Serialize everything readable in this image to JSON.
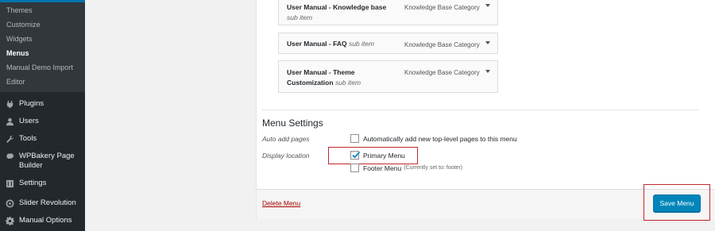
{
  "sidebar": {
    "submenu": [
      {
        "label": "Themes"
      },
      {
        "label": "Customize"
      },
      {
        "label": "Widgets"
      },
      {
        "label": "Menus"
      },
      {
        "label": "Manual Demo Import"
      },
      {
        "label": "Editor"
      }
    ],
    "menu": [
      {
        "label": "Plugins",
        "icon": "plug-icon"
      },
      {
        "label": "Users",
        "icon": "users-icon"
      },
      {
        "label": "Tools",
        "icon": "wrench-icon"
      },
      {
        "label": "WPBakery Page Builder",
        "icon": "wpbakery-icon"
      },
      {
        "label": "Settings",
        "icon": "settings-icon"
      },
      {
        "label": "Slider Revolution",
        "icon": "slider-revolution-icon"
      },
      {
        "label": "Manual Options",
        "icon": "gear-icon"
      }
    ]
  },
  "menu_items": [
    {
      "title": "User Manual - Knowledge base",
      "sub": "sub item",
      "type": "Knowledge Base Category"
    },
    {
      "title": "User Manual - FAQ",
      "sub": "sub item",
      "type": "Knowledge Base Category"
    },
    {
      "title": "User Manual - Theme Customization",
      "sub": "sub item",
      "type": "Knowledge Base Category"
    }
  ],
  "settings": {
    "title": "Menu Settings",
    "auto_add_label": "Auto add pages",
    "auto_add_option": "Automatically add new top-level pages to this menu",
    "display_location_label": "Display location",
    "primary_menu": "Primary Menu",
    "footer_menu": "Footer Menu",
    "footer_note": "(Currently set to: footer)"
  },
  "footer": {
    "delete_label": "Delete Menu",
    "save_label": "Save Menu"
  },
  "colors": {
    "sidebar_bg": "#23282d",
    "accent": "#0073aa",
    "save_button": "#0085ba",
    "delete_link": "#a00000",
    "highlight": "#c0282f"
  }
}
